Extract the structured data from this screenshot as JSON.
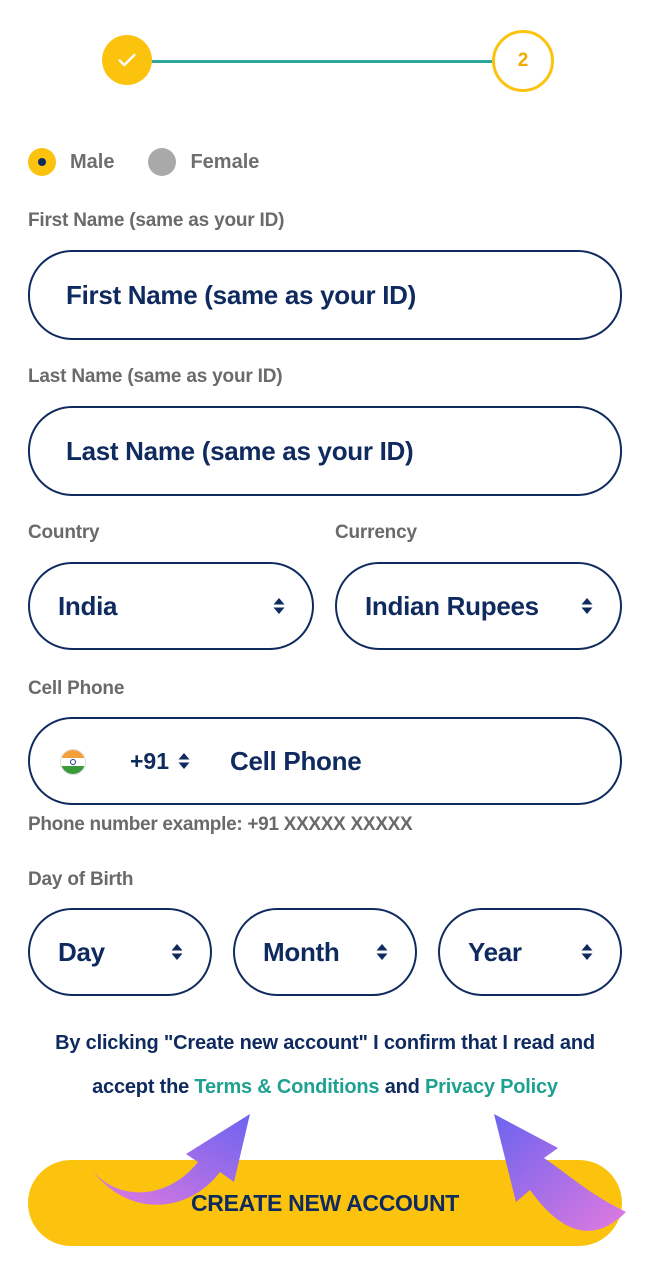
{
  "stepper": {
    "step2_label": "2"
  },
  "gender": {
    "male_label": "Male",
    "female_label": "Female",
    "selected": "male"
  },
  "first_name": {
    "label": "First Name (same as your ID)",
    "placeholder": "First Name  (same as your ID)"
  },
  "last_name": {
    "label": "Last Name (same as your ID)",
    "placeholder": "Last Name (same as your ID)"
  },
  "country": {
    "label": "Country",
    "value": "India"
  },
  "currency": {
    "label": "Currency",
    "value": "Indian Rupees"
  },
  "cell_phone": {
    "label": "Cell Phone",
    "code": "+91",
    "placeholder": "Cell Phone",
    "hint": "Phone number example: +91 XXXXX XXXXX"
  },
  "birth": {
    "label": "Day of Birth",
    "day": "Day",
    "month": "Month",
    "year": "Year"
  },
  "consent": {
    "line1": "By clicking \"Create new account\" I confirm that I read and",
    "prefix": "accept the ",
    "terms": "Terms & Conditions",
    "and": " and ",
    "privacy": "Privacy Policy"
  },
  "cta": {
    "label": "CREATE NEW ACCOUNT"
  },
  "colors": {
    "accent": "#fbc30d",
    "navy": "#0f2a5e",
    "teal": "#1fa192",
    "arrow": "#9b5de5"
  }
}
